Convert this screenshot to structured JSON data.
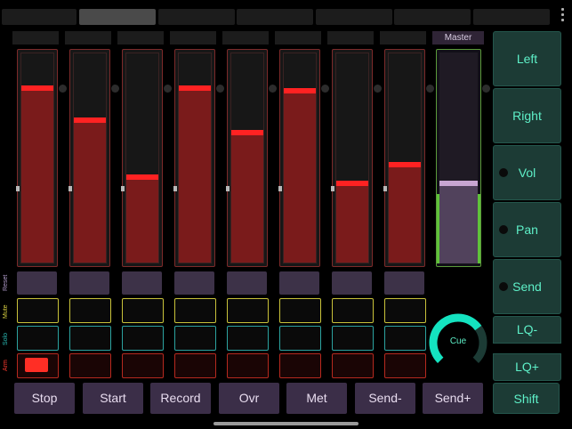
{
  "master": {
    "label": "Master",
    "level": 0.38
  },
  "channels": [
    {
      "level": 0.83
    },
    {
      "level": 0.68
    },
    {
      "level": 0.41
    },
    {
      "level": 0.83
    },
    {
      "level": 0.62
    },
    {
      "level": 0.82
    },
    {
      "level": 0.38
    },
    {
      "level": 0.47
    }
  ],
  "row_labels": {
    "reset": "Reset",
    "mute": "Mute",
    "solo": "Solo",
    "arm": "Arm"
  },
  "armed": [
    true,
    false,
    false,
    false,
    false,
    false,
    false,
    false
  ],
  "side_buttons": [
    "Left",
    "Right",
    "Vol",
    "Pan",
    "Send"
  ],
  "lq": {
    "minus": "LQ-",
    "plus": "LQ+"
  },
  "cue": {
    "label": "Cue",
    "level": 0.7
  },
  "bottom_buttons": [
    "Stop",
    "Start",
    "Record",
    "Ovr",
    "Met",
    "Send-",
    "Send+"
  ],
  "shift": "Shift",
  "colors": {
    "fader_red": "#ff2222",
    "master_handle": "#c8a6d2",
    "accent": "#5ef0c8",
    "arm": "#ff2e25"
  }
}
